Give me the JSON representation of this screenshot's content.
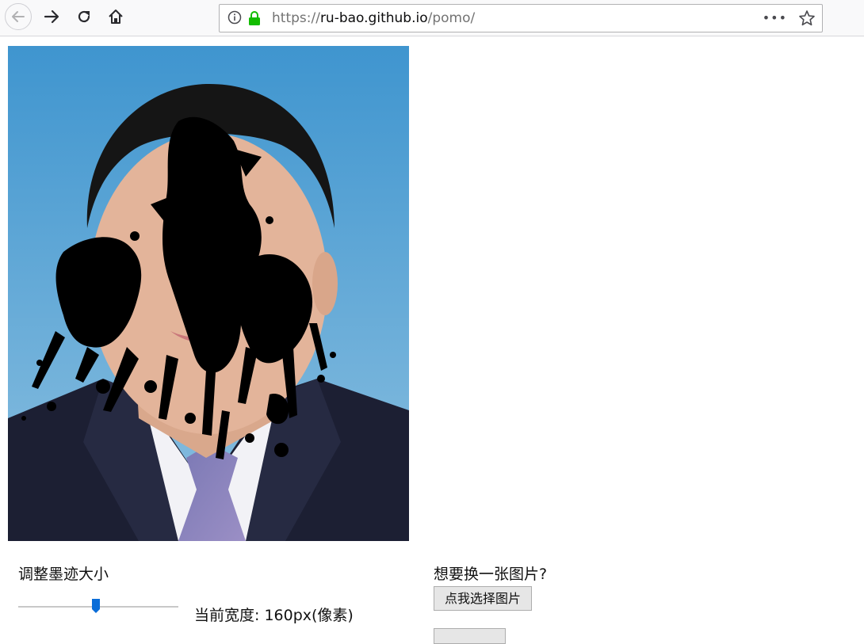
{
  "browser": {
    "url_scheme": "https://",
    "url_host": "ru-bao.github.io",
    "url_path": "/pomo/",
    "more_label": "•••",
    "icons": [
      "back-arrow-icon",
      "forward-arrow-icon",
      "reload-icon",
      "home-icon",
      "info-icon",
      "lock-icon",
      "bookmark-star-icon"
    ]
  },
  "image": {
    "description_icon": "portrait-with-ink-splatter",
    "colors": {
      "background_top": "#3f95cf",
      "background_bottom": "#86bcdf",
      "suit": "#1c1f33",
      "ink": "#000000"
    }
  },
  "controls": {
    "ink_size_title": "调整墨迹大小",
    "slider_value_fraction": 0.49,
    "width_label": "当前宽度: 160px(像素)",
    "change_image_title": "想要换一张图片?",
    "pick_button_label": "点我选择图片",
    "accent_color": "#0a6dd8"
  }
}
